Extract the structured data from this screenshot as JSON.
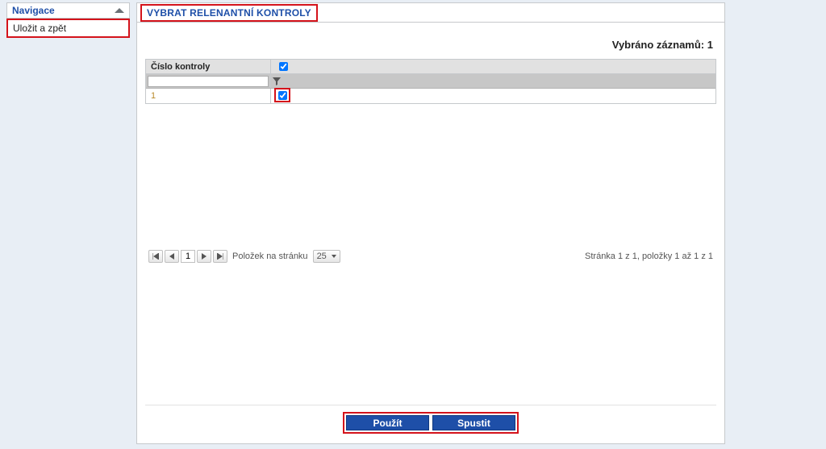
{
  "sidebar": {
    "header": "Navigace",
    "items": [
      {
        "label": "Uložit a zpět"
      }
    ]
  },
  "panel": {
    "title": "VYBRAT RELENANTNÍ KONTROLY",
    "selection_label": "Vybráno záznamů:",
    "selection_count": "1"
  },
  "grid": {
    "headers": {
      "number": "Číslo kontroly"
    },
    "filter_value": "",
    "rows": [
      {
        "number": "1",
        "checked": true
      }
    ]
  },
  "pager": {
    "page": "1",
    "items_label": "Položek na stránku",
    "page_size": "25",
    "status": "Stránka 1 z 1, položky 1 až 1 z 1"
  },
  "footer": {
    "apply": "Použít",
    "run": "Spustit"
  }
}
